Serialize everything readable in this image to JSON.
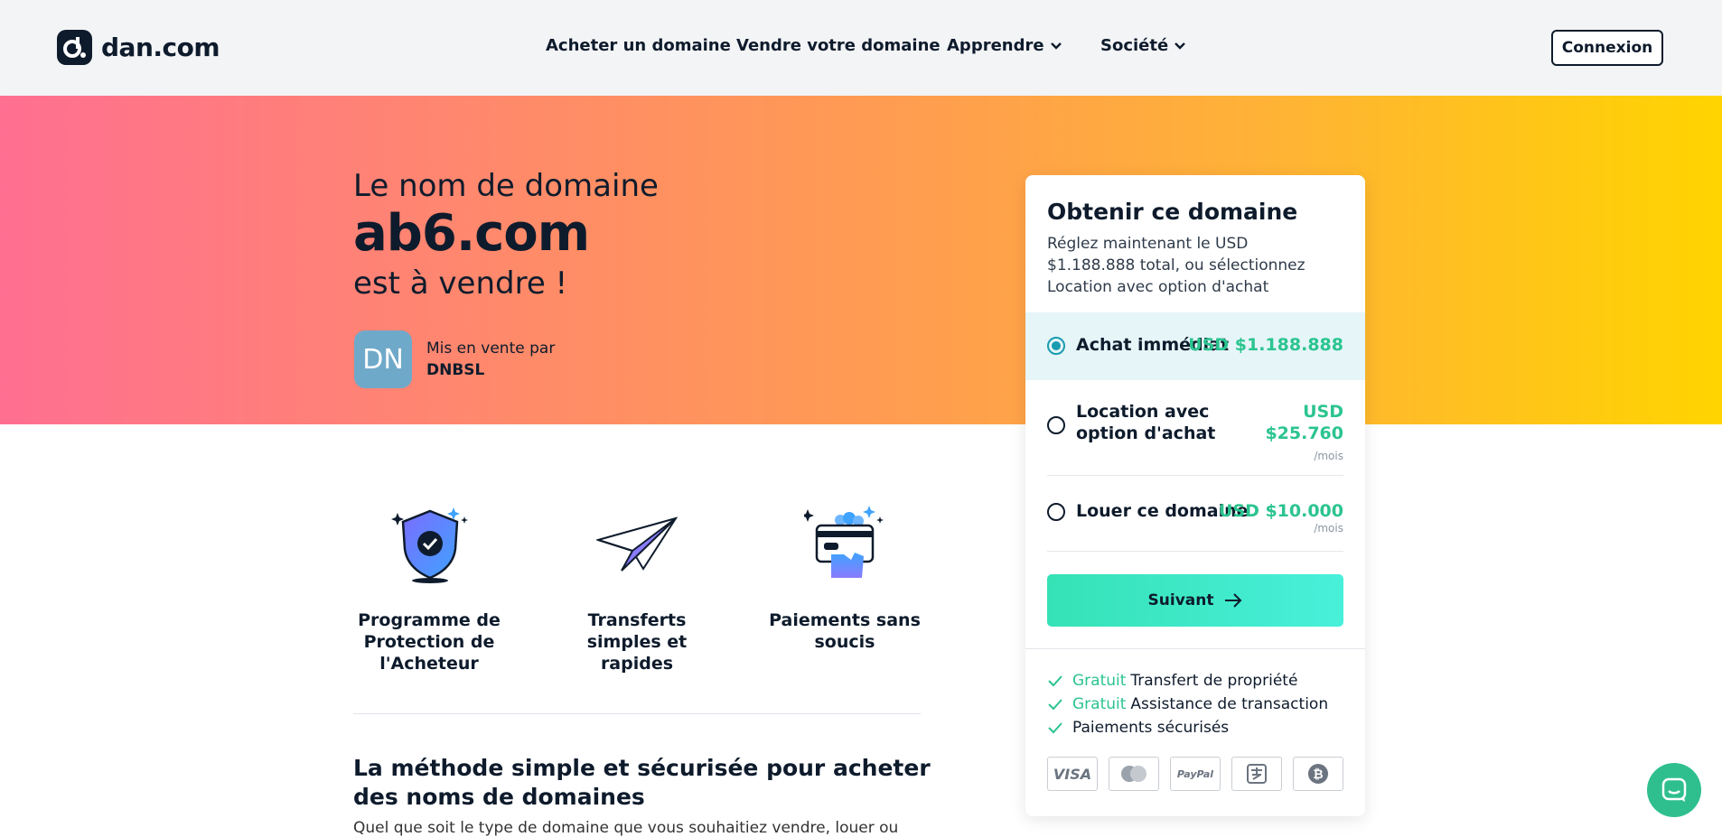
{
  "header": {
    "logo_text": "dan.com",
    "nav": [
      "Acheter un domaine",
      "Vendre votre domaine",
      "Apprendre",
      "Société"
    ],
    "login_label": "Connexion"
  },
  "hero": {
    "line1": "Le nom de domaine",
    "domain": "ab6.com",
    "line2": "est à vendre !",
    "avatar_initials": "DN",
    "seller_label": "Mis en vente par",
    "seller_name": "DNBSL"
  },
  "features": [
    {
      "label": "Programme de Protection de l'Acheteur",
      "icon": "shield-check-icon"
    },
    {
      "label": "Transferts simples et rapides",
      "icon": "paper-plane-icon"
    },
    {
      "label": "Paiements sans soucis",
      "icon": "card-hand-icon"
    }
  ],
  "section": {
    "title": "La méthode simple et sécurisée pour acheter des noms de domaines",
    "text": "Quel que soit le type de domaine que vous souhaitiez vendre, louer ou"
  },
  "card": {
    "title": "Obtenir ce domaine",
    "description": "Réglez maintenant le USD $1.188.888 total, ou sélectionnez Location avec option d'achat",
    "options": [
      {
        "label": "Achat immédiat",
        "price": "USD $1.188.888",
        "unit": "",
        "selected": true
      },
      {
        "label": "Location avec option d'achat",
        "price": "USD $25.760",
        "unit": "/mois",
        "selected": false
      },
      {
        "label": "Louer ce domaine",
        "price": "USD $10.000",
        "unit": "/mois",
        "selected": false
      }
    ],
    "next_label": "Suivant",
    "perks": [
      {
        "free": "Gratuit",
        "text": "Transfert de propriété"
      },
      {
        "free": "Gratuit",
        "text": "Assistance de transaction"
      },
      {
        "free": "",
        "text": "Paiements sécurisés"
      }
    ],
    "payment_methods": [
      "VISA",
      "mastercard",
      "PayPal",
      "alipay",
      "bitcoin"
    ]
  },
  "colors": {
    "accent_green": "#2bc48f",
    "radio_selected": "#1a9bb0",
    "hero_gradient_start": "#ff6f91",
    "hero_gradient_end": "#ffd400"
  }
}
